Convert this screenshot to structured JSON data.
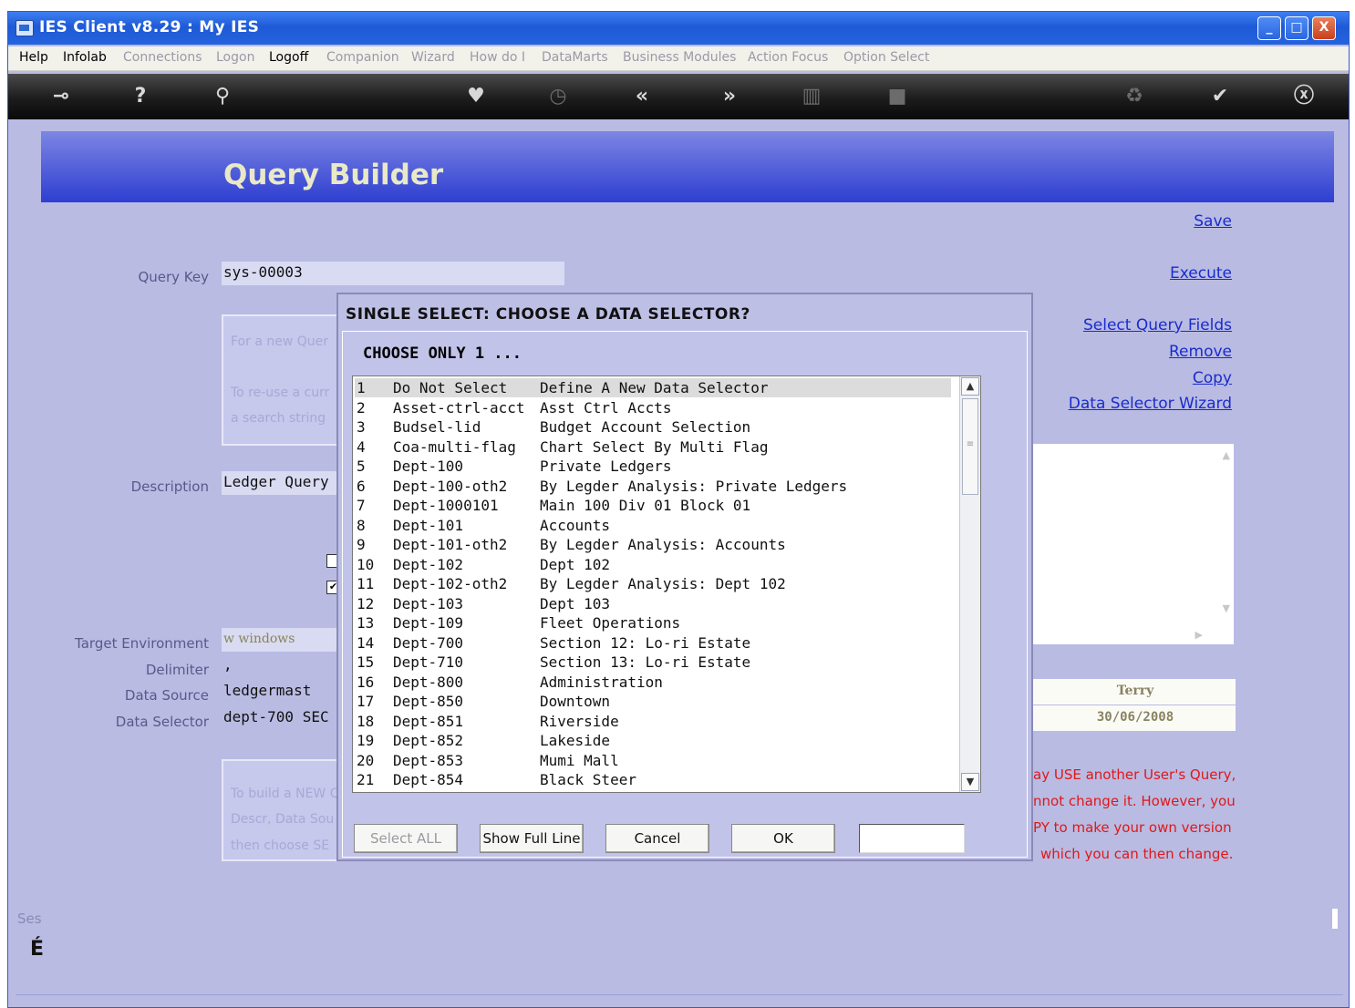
{
  "window": {
    "title": "IES Client v8.29 : My IES",
    "controls": {
      "minimize": "_",
      "maximize": "□",
      "close": "X"
    }
  },
  "menu": [
    {
      "label": "Help",
      "enabled": true
    },
    {
      "label": "Infolab",
      "enabled": true
    },
    {
      "label": "Connections",
      "enabled": false
    },
    {
      "label": "Logon",
      "enabled": false
    },
    {
      "label": "Logoff",
      "enabled": true
    },
    {
      "label": "Companion",
      "enabled": false
    },
    {
      "label": "Wizard",
      "enabled": false
    },
    {
      "label": "How do I",
      "enabled": false
    },
    {
      "label": "DataMarts",
      "enabled": false
    },
    {
      "label": "Business Modules",
      "enabled": false
    },
    {
      "label": "Action Focus",
      "enabled": false
    },
    {
      "label": "Option Select",
      "enabled": false
    }
  ],
  "toolbar": [
    "key-icon",
    "help-icon",
    "search-icon",
    "heart-icon",
    "clock-icon",
    "rewind-icon",
    "fast-forward-icon",
    "column-icon",
    "square-icon",
    "recycle-icon",
    "check-icon",
    "close-icon"
  ],
  "page": {
    "banner_title": "Query Builder",
    "links": {
      "save": "Save",
      "execute": "Execute",
      "select_query_fields": "Select Query Fields",
      "remove": "Remove",
      "copy": "Copy",
      "data_selector_wizard": "Data Selector Wizard"
    },
    "labels": {
      "query_key": "Query Key",
      "description": "Description",
      "target_environment": "Target Environment",
      "delimiter": "Delimiter",
      "data_source": "Data Source",
      "data_selector": "Data Selector"
    },
    "values": {
      "query_key": "sys-00003",
      "description": "Ledger Query",
      "target_environment": "w    windows",
      "delimiter": ",",
      "data_source": "ledgermast",
      "data_selector": "dept-700 SEC",
      "user": "Terry",
      "date": "30/06/2008"
    },
    "hints_top": [
      "For a new Quer",
      "To re-use a curr",
      "a search string"
    ],
    "hints_bottom": [
      "To build a NEW Q",
      "Descr, Data Sou",
      "then choose SE"
    ],
    "red_notes": [
      "ay USE another User's Query,",
      "nnot change it. However, you",
      "PY to make your own version",
      "which you can then change."
    ],
    "footer_label": "Ses",
    "footer_glyph": "É"
  },
  "dialog": {
    "title": "SINGLE SELECT: CHOOSE A DATA SELECTOR?",
    "prompt": "CHOOSE ONLY 1 ...",
    "items": [
      {
        "num": "1",
        "code": "Do Not Select",
        "desc": "Define A New Data Selector"
      },
      {
        "num": "2",
        "code": "Asset-ctrl-acct",
        "desc": "Asst Ctrl Accts"
      },
      {
        "num": "3",
        "code": "Budsel-lid",
        "desc": "Budget Account Selection"
      },
      {
        "num": "4",
        "code": "Coa-multi-flag",
        "desc": "Chart Select By Multi Flag"
      },
      {
        "num": "5",
        "code": "Dept-100",
        "desc": "Private Ledgers"
      },
      {
        "num": "6",
        "code": "Dept-100-oth2",
        "desc": "By Legder Analysis: Private Ledgers"
      },
      {
        "num": "7",
        "code": "Dept-1000101",
        "desc": "Main 100 Div 01 Block 01"
      },
      {
        "num": "8",
        "code": "Dept-101",
        "desc": "Accounts"
      },
      {
        "num": "9",
        "code": "Dept-101-oth2",
        "desc": "By Legder Analysis: Accounts"
      },
      {
        "num": "10",
        "code": "Dept-102",
        "desc": "Dept 102"
      },
      {
        "num": "11",
        "code": "Dept-102-oth2",
        "desc": "By Legder Analysis: Dept 102"
      },
      {
        "num": "12",
        "code": "Dept-103",
        "desc": "Dept 103"
      },
      {
        "num": "13",
        "code": "Dept-109",
        "desc": "Fleet Operations"
      },
      {
        "num": "14",
        "code": "Dept-700",
        "desc": "Section 12: Lo-ri Estate"
      },
      {
        "num": "15",
        "code": "Dept-710",
        "desc": "Section 13: Lo-ri Estate"
      },
      {
        "num": "16",
        "code": "Dept-800",
        "desc": "Administration"
      },
      {
        "num": "17",
        "code": "Dept-850",
        "desc": "Downtown"
      },
      {
        "num": "18",
        "code": "Dept-851",
        "desc": "Riverside"
      },
      {
        "num": "19",
        "code": "Dept-852",
        "desc": "Lakeside"
      },
      {
        "num": "20",
        "code": "Dept-853",
        "desc": "Mumi Mall"
      },
      {
        "num": "21",
        "code": "Dept-854",
        "desc": "Black Steer"
      }
    ],
    "selected_index": 0,
    "buttons": {
      "select_all": "Select ALL",
      "show_full_line": "Show Full Line",
      "cancel": "Cancel",
      "ok": "OK"
    },
    "input_value": ""
  }
}
